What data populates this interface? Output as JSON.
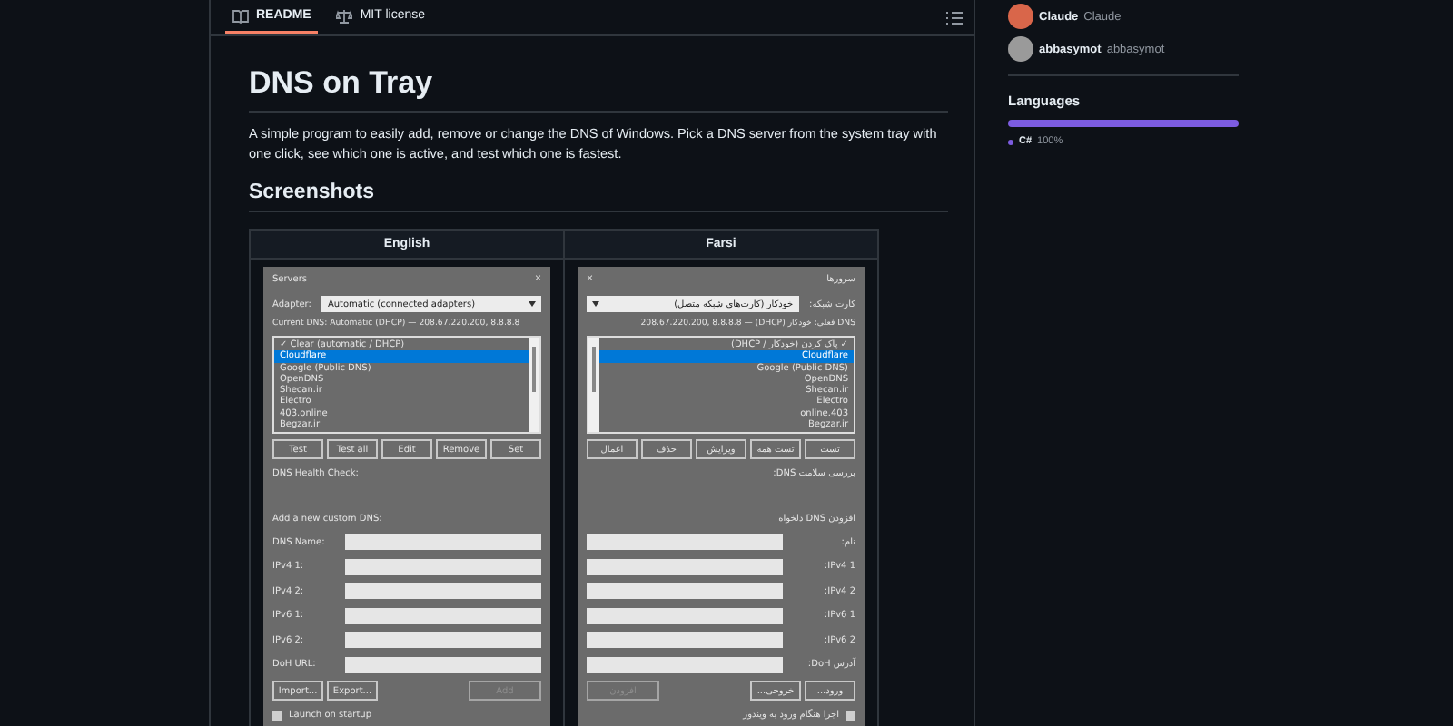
{
  "readme": {
    "tabs": [
      {
        "label": "README",
        "selected": true
      },
      {
        "label": "MIT license",
        "selected": false
      }
    ],
    "title": "DNS on Tray",
    "description": "A simple program to easily add, remove or change the DNS of Windows. Pick a DNS server from the system tray with one click, see which one is active, and test which one is fastest.",
    "section_heading": "Screenshots",
    "screenshots": [
      {
        "heading": "English",
        "window": {
          "kind": "ltr",
          "title": "Servers",
          "close": "×",
          "adapter_label": "Adapter:",
          "adapter_value": "Automatic (connected adapters)",
          "current_dns": "Current DNS: Automatic (DHCP) — 208.67.220.200, 8.8.8.8",
          "servers": [
            {
              "name": "✓ Clear (automatic / DHCP)",
              "selected": false
            },
            {
              "name": "Cloudflare",
              "selected": true
            },
            {
              "name": "Google (Public DNS)",
              "selected": false
            },
            {
              "name": "OpenDNS",
              "selected": false
            },
            {
              "name": "Shecan.ir",
              "selected": false
            },
            {
              "name": "Electro",
              "selected": false
            },
            {
              "name": "403.online",
              "selected": false
            },
            {
              "name": "Begzar.ir",
              "selected": false
            }
          ],
          "actions": [
            "Test",
            "Test all",
            "Edit",
            "Remove",
            "Set"
          ],
          "health_check": "DNS Health Check:",
          "add_heading": "Add a new custom DNS:",
          "fields": [
            "DNS Name:",
            "IPv4 1:",
            "IPv4 2:",
            "IPv6 1:",
            "IPv6 2:",
            "DoH URL:"
          ],
          "bottom_buttons": [
            {
              "label": "Import...",
              "disabled": false
            },
            {
              "label": "Export...",
              "disabled": false
            },
            {
              "label": "Add",
              "disabled": true
            }
          ],
          "startup": {
            "label": "Launch on startup",
            "checked": false
          }
        }
      },
      {
        "heading": "Farsi",
        "window": {
          "kind": "rtl",
          "title": "سرورها",
          "close": "×",
          "adapter_label": "کارت شبکه:",
          "adapter_value": "خودکار (کارت‌های شبکه متصل)",
          "current_dns": "DNS فعلی: خودکار (DHCP) — 208.67.220.200, 8.8.8.8",
          "servers": [
            {
              "name": "✓ پاک کردن (خودکار / DHCP)",
              "selected": false
            },
            {
              "name": "Cloudflare",
              "selected": true
            },
            {
              "name": "Google (Public DNS)",
              "selected": false
            },
            {
              "name": "OpenDNS",
              "selected": false
            },
            {
              "name": "Shecan.ir",
              "selected": false
            },
            {
              "name": "Electro",
              "selected": false
            },
            {
              "name": "403.online",
              "selected": false
            },
            {
              "name": "Begzar.ir",
              "selected": false
            }
          ],
          "actions": [
            "تست",
            "تست همه",
            "ویرایش",
            "حذف",
            "اعمال"
          ],
          "health_check": "بررسی سلامت DNS:",
          "add_heading": "افزودن DNS دلخواه",
          "fields": [
            "نام:",
            "IPv4 1:",
            "IPv4 2:",
            "IPv6 1:",
            "IPv6 2:",
            "آدرس DoH:"
          ],
          "bottom_buttons": [
            {
              "label": "ورود...",
              "disabled": false
            },
            {
              "label": "خروجی...",
              "disabled": false
            },
            {
              "label": "افزودن",
              "disabled": true
            }
          ],
          "startup": {
            "label": "اجرا هنگام ورود به ویندوز",
            "checked": false
          }
        }
      }
    ]
  },
  "sidebar": {
    "contributors": [
      {
        "login": "Claude",
        "name": "Claude",
        "color": "#d9664a"
      },
      {
        "login": "abbasymot",
        "name": "abbasymot",
        "color": "#9a9a9a"
      }
    ],
    "languages_heading": "Languages",
    "languages": [
      {
        "name": "C#",
        "percent": "100%",
        "color": "#7c5ce0"
      }
    ]
  }
}
